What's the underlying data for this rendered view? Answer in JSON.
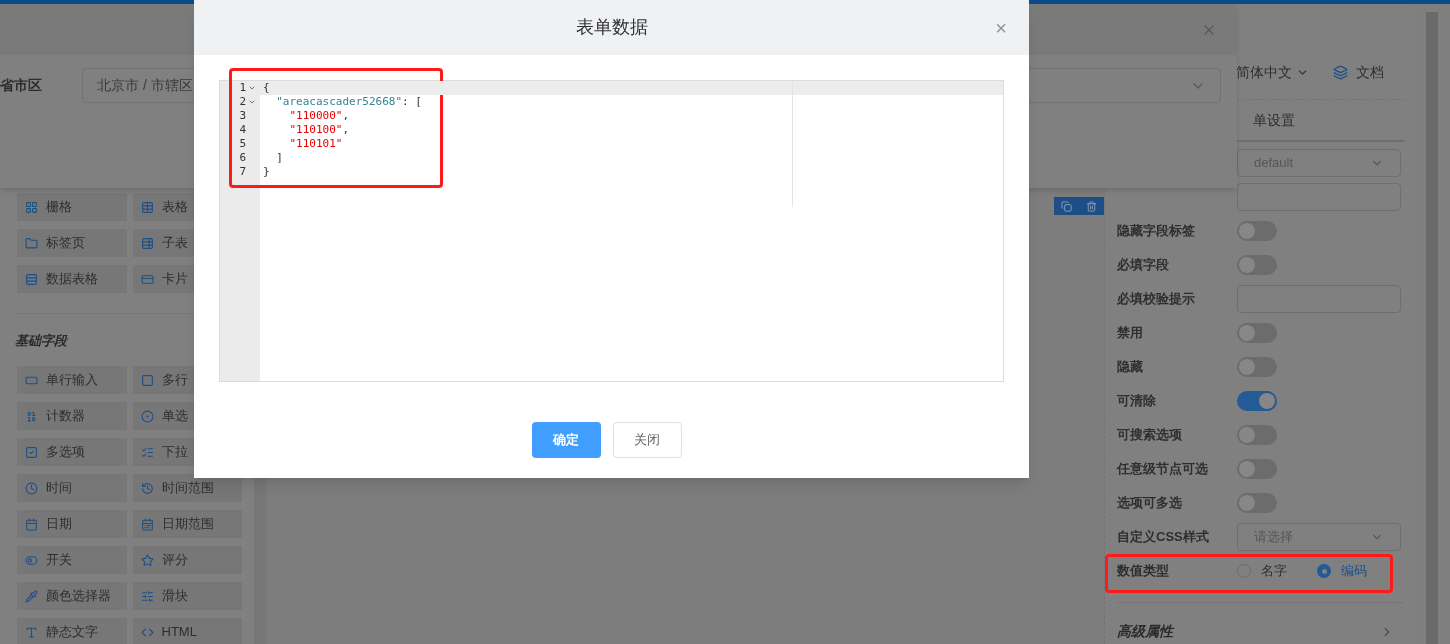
{
  "background_dialog": {
    "field_label": "省市区",
    "field_value": "北京市 / 市辖区"
  },
  "palette": {
    "top_items": [
      {
        "label": "栅格"
      },
      {
        "label": "表格"
      },
      {
        "label": "标签页"
      },
      {
        "label": "子表"
      },
      {
        "label": "数据表格"
      },
      {
        "label": "卡片"
      }
    ],
    "section_title": "基础字段",
    "basic_items": [
      {
        "label": "单行输入"
      },
      {
        "label": "多行"
      },
      {
        "label": "计数器"
      },
      {
        "label": "单选"
      },
      {
        "label": "多选项"
      },
      {
        "label": "下拉"
      },
      {
        "label": "时间"
      },
      {
        "label": "时间范围"
      },
      {
        "label": "日期"
      },
      {
        "label": "日期范围"
      },
      {
        "label": "开关"
      },
      {
        "label": "评分"
      },
      {
        "label": "颜色选择器"
      },
      {
        "label": "滑块"
      },
      {
        "label": "静态文字"
      },
      {
        "label": "HTML"
      }
    ]
  },
  "header": {
    "language": "简体中文",
    "docs": "文档"
  },
  "settings": {
    "tab": "单设置",
    "rows": [
      {
        "kind": "select",
        "value": "default"
      },
      {
        "kind": "input"
      },
      {
        "kind": "switch",
        "label": "隐藏字段标签",
        "on": false
      },
      {
        "kind": "switch",
        "label": "必填字段",
        "on": false
      },
      {
        "kind": "input",
        "label": "必填校验提示"
      },
      {
        "kind": "switch",
        "label": "禁用",
        "on": false
      },
      {
        "kind": "switch",
        "label": "隐藏",
        "on": false
      },
      {
        "kind": "switch",
        "label": "可清除",
        "on": true
      },
      {
        "kind": "switch",
        "label": "可搜索选项",
        "on": false
      },
      {
        "kind": "switch",
        "label": "任意级节点可选",
        "on": false
      },
      {
        "kind": "switch",
        "label": "选项可多选",
        "on": false
      },
      {
        "kind": "select",
        "label": "自定义CSS样式",
        "placeholder": "请选择"
      },
      {
        "kind": "radio",
        "label": "数值类型",
        "highlighted": true,
        "options": [
          {
            "label": "名字",
            "selected": false
          },
          {
            "label": "编码",
            "selected": true
          }
        ]
      }
    ],
    "section": "高级属性"
  },
  "modal": {
    "title": "表单数据",
    "close": "×",
    "code": {
      "highlighted": true,
      "lines": [
        {
          "number": "1",
          "fold": true,
          "tokens": [
            {
              "kind": "punct",
              "text": "{"
            }
          ]
        },
        {
          "number": "2",
          "fold": true,
          "tokens": [
            {
              "kind": "key",
              "text": "  \"areacascader52668\""
            },
            {
              "kind": "punct",
              "text": ": ["
            }
          ]
        },
        {
          "number": "3",
          "fold": false,
          "tokens": [
            {
              "kind": "string",
              "text": "    \"110000\""
            },
            {
              "kind": "punct",
              "text": ","
            }
          ]
        },
        {
          "number": "4",
          "fold": false,
          "tokens": [
            {
              "kind": "string",
              "text": "    \"110100\""
            },
            {
              "kind": "punct",
              "text": ","
            }
          ]
        },
        {
          "number": "5",
          "fold": false,
          "tokens": [
            {
              "kind": "string",
              "text": "    \"110101\""
            }
          ]
        },
        {
          "number": "6",
          "fold": false,
          "tokens": [
            {
              "kind": "punct",
              "text": "  ]"
            }
          ]
        },
        {
          "number": "7",
          "fold": false,
          "tokens": [
            {
              "kind": "punct",
              "text": "}"
            }
          ]
        }
      ]
    },
    "buttons": [
      {
        "label": "确定",
        "kind": "primary"
      },
      {
        "label": "关闭",
        "kind": "default"
      }
    ]
  }
}
